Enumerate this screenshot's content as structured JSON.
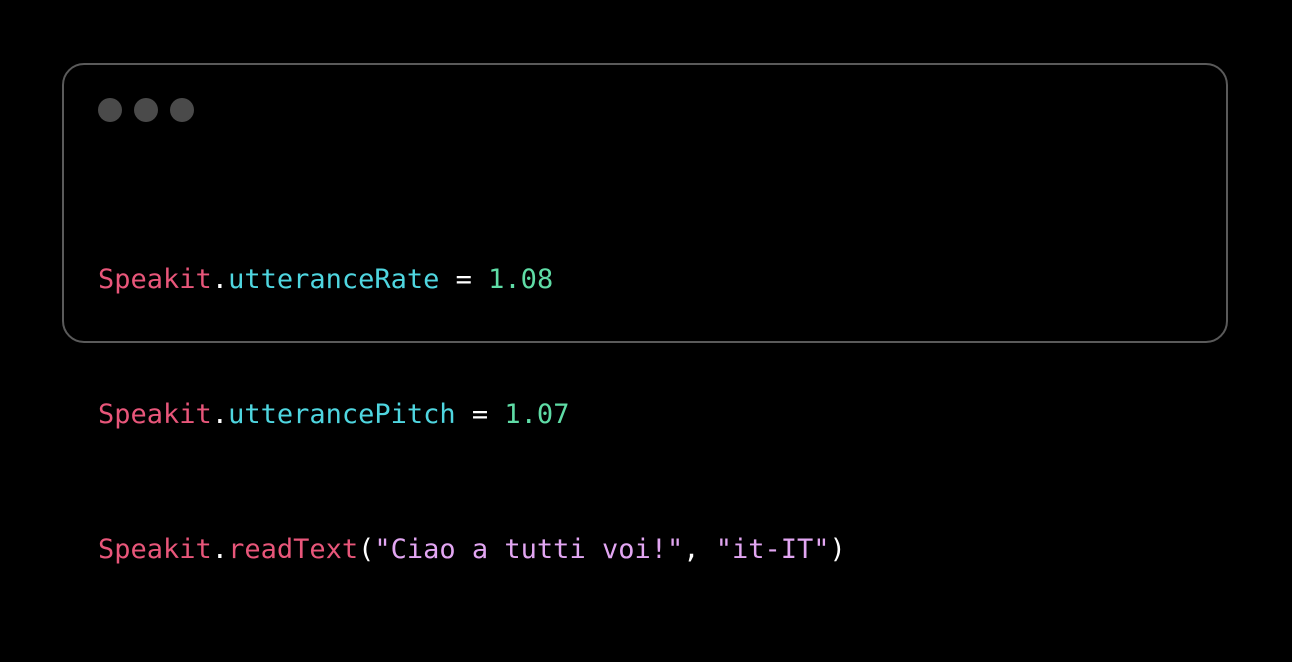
{
  "window": {
    "controls": [
      "close",
      "minimize",
      "zoom"
    ]
  },
  "code": {
    "lines": [
      {
        "object": "Speakit",
        "dot": ".",
        "member": "utteranceRate",
        "op": " = ",
        "value": "1.08"
      },
      {
        "object": "Speakit",
        "dot": ".",
        "member": "utterancePitch",
        "op": " = ",
        "value": "1.07"
      },
      {
        "object": "Speakit",
        "dot": ".",
        "member": "readText",
        "open": "(",
        "arg1": "\"Ciao a tutti voi!\"",
        "sep": ", ",
        "arg2": "\"it-IT\"",
        "close": ")"
      }
    ]
  },
  "colors": {
    "object": "#e8567a",
    "member": "#4fd6e0",
    "number": "#5fdca6",
    "string": "#e2a6f2",
    "window_border": "#5a5a5a",
    "window_dot": "#4a4a4a"
  }
}
